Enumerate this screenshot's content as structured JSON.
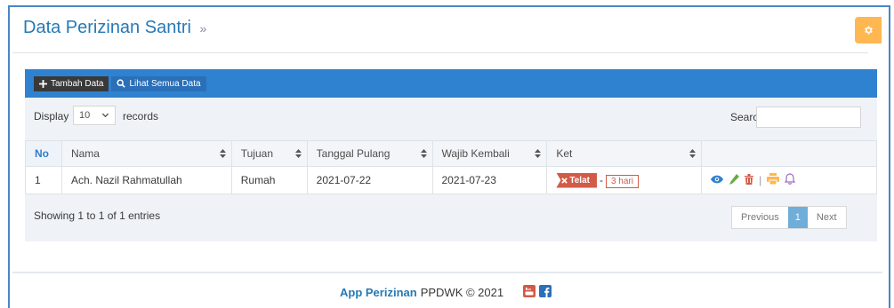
{
  "page": {
    "title": "Data Perizinan Santri",
    "title_suffix": "»"
  },
  "toolbar": {
    "add_label": "Tambah Data",
    "view_all_label": "Lihat Semua Data"
  },
  "length": {
    "display_label": "Display",
    "selected": "10",
    "records_label": "records"
  },
  "search": {
    "label": "Search:",
    "value": ""
  },
  "table": {
    "headers": [
      "No",
      "Nama",
      "Tujuan",
      "Tanggal Pulang",
      "Wajib Kembali",
      "Ket",
      ""
    ],
    "rows": [
      {
        "no": "1",
        "nama": "Ach. Nazil Rahmatullah",
        "tujuan": "Rumah",
        "tanggal_pulang": "2021-07-22",
        "wajib_kembali": "2021-07-23",
        "status": "Telat",
        "status_sep": "-",
        "days": "3 hari"
      }
    ]
  },
  "info": "Showing 1 to 1 of 1 entries",
  "pagination": {
    "previous": "Previous",
    "current": "1",
    "next": "Next"
  },
  "footer": {
    "app_name": "App Perizinan",
    "org_copyright": "PPDWK © 2021"
  },
  "icons": {
    "settings": "gear-icon",
    "add": "plus-icon",
    "search": "search-icon",
    "sort": "sort-icon",
    "status": "times-icon",
    "view": "eye-icon",
    "edit": "pencil-icon",
    "delete": "trash-icon",
    "print": "print-icon",
    "notify": "bell-icon",
    "youtube": "youtube-icon",
    "facebook": "facebook-icon"
  },
  "colors": {
    "accent": "#2f82cf",
    "title": "#2679b5",
    "danger": "#d15b47",
    "warning": "#ffb752",
    "success": "#69aa46",
    "info": "#6faed9",
    "purple": "#a069c3"
  }
}
